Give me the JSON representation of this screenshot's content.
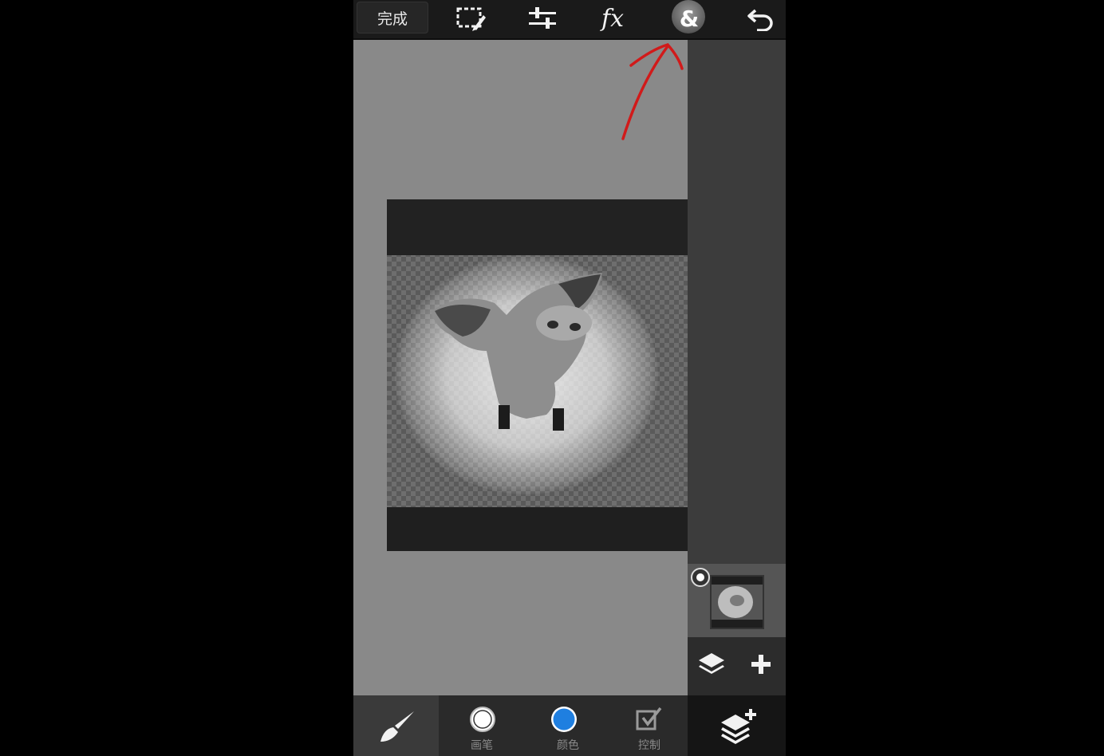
{
  "toolbar": {
    "done_label": "完成",
    "items": [
      "select-icon",
      "adjust-icon",
      "fx-icon",
      "blend-icon",
      "undo-icon"
    ],
    "fx_label": "fx",
    "blend_label": "&"
  },
  "bottom": {
    "brush_label": "",
    "paint_label": "画笔",
    "color_label": "颜色",
    "control_label": "控制",
    "color_value": "#1f7fe0"
  },
  "annotation": {
    "arrow_color": "#d11a1a"
  }
}
